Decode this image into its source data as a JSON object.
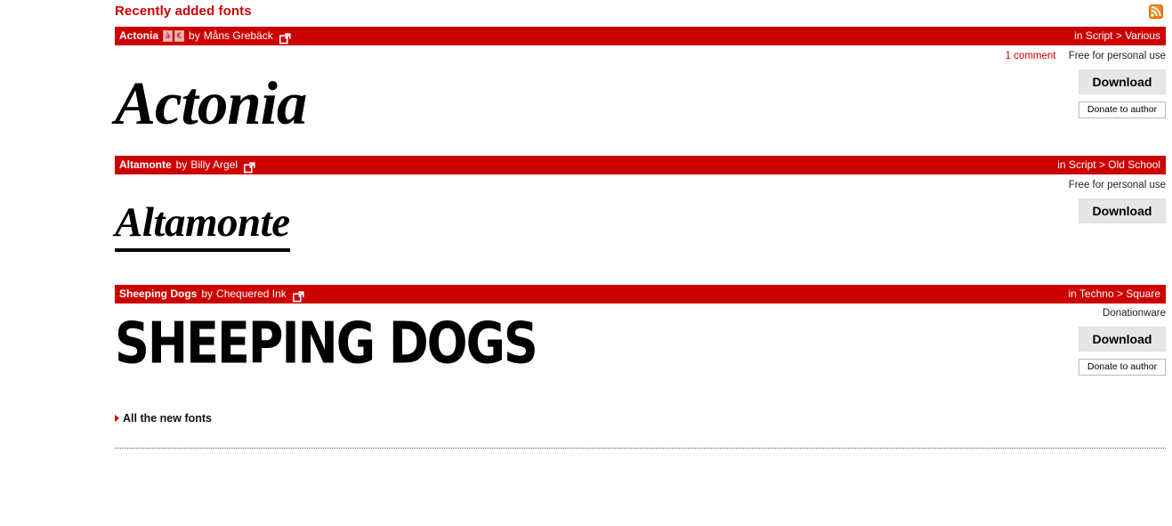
{
  "header": {
    "title": "Recently added fonts",
    "rss_icon": "rss-feed-icon",
    "accent_color": "#cc0000",
    "rss_color": "#e8761a"
  },
  "fonts": [
    {
      "name": "Actonia",
      "by_word": "by",
      "author": "Måns Grebäck",
      "badges": [
        "à",
        "€"
      ],
      "external_link_icon": "external-link-icon",
      "category": "in Script > Various",
      "comment_text": "1 comment",
      "license": "Free for personal use",
      "download_label": "Download",
      "donate_label": "Donate to author",
      "preview_text": "Actonia"
    },
    {
      "name": "Altamonte",
      "by_word": "by",
      "author": "Billy Argel",
      "badges": [],
      "external_link_icon": "external-link-icon",
      "category": "in Script > Old School",
      "comment_text": "",
      "license": "Free for personal use",
      "download_label": "Download",
      "donate_label": "",
      "preview_text": "Altamonte"
    },
    {
      "name": "Sheeping Dogs",
      "by_word": "by",
      "author": "Chequered Ink",
      "badges": [],
      "external_link_icon": "external-link-icon",
      "category": "in Techno > Square",
      "comment_text": "",
      "license": "Donationware",
      "download_label": "Download",
      "donate_label": "Donate to author",
      "preview_text": "SHEEPING DOGS"
    }
  ],
  "footer": {
    "all_new_fonts_label": "All the new fonts",
    "bullet_icon": "triangle-right-icon"
  }
}
